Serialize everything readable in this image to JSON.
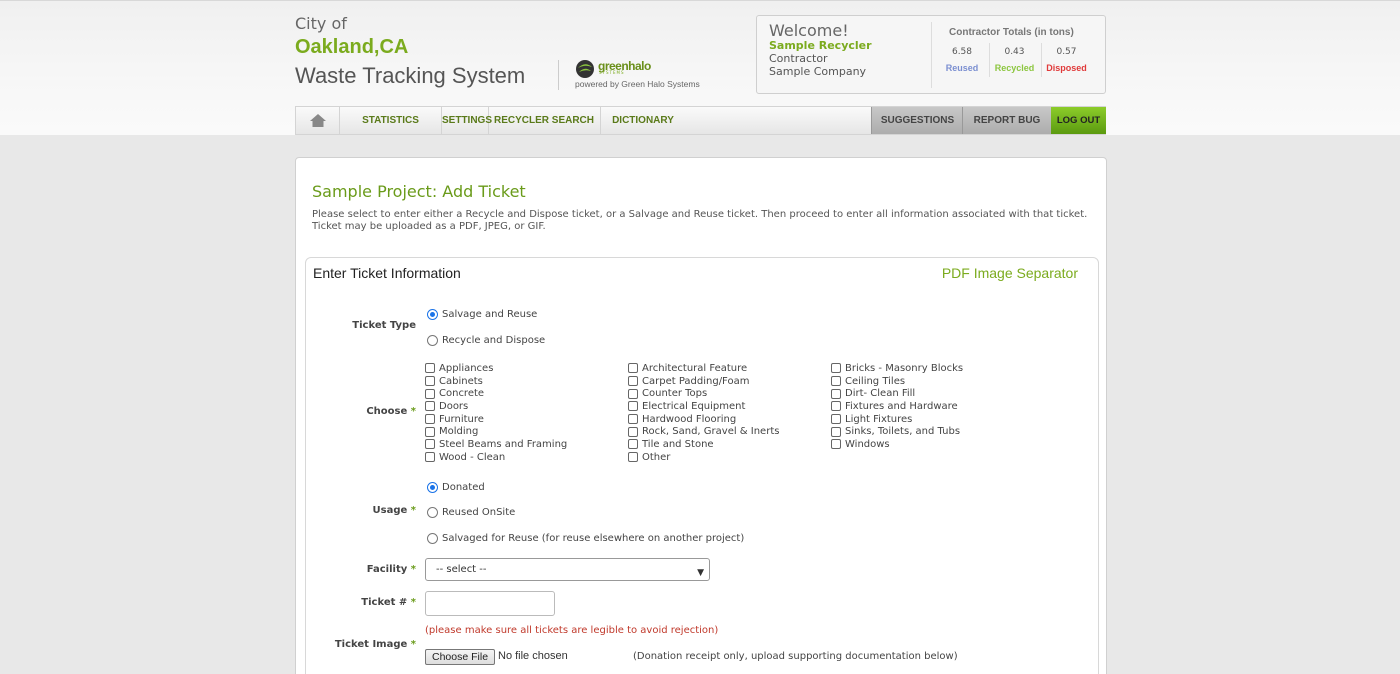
{
  "brand": {
    "city": "City of",
    "name": "Oakland,CA",
    "system": "Waste Tracking System",
    "partner_name": "greenhalo",
    "partner_sub": "SYSTEMS",
    "powered_by": "powered by Green Halo Systems"
  },
  "welcome": {
    "title": "Welcome!",
    "user": "Sample Recycler",
    "role": "Contractor",
    "company": "Sample Company"
  },
  "totals": {
    "title": "Contractor Totals (in tons)",
    "items": [
      {
        "value": "6.58",
        "label": "Reused",
        "color": "#7b8fd1"
      },
      {
        "value": "0.43",
        "label": "Recycled",
        "color": "#8cc63f"
      },
      {
        "value": "0.57",
        "label": "Disposed",
        "color": "#e03a3a"
      }
    ]
  },
  "nav": {
    "home_icon": "home-icon",
    "items": [
      "STATISTICS",
      "SETTINGS",
      "RECYCLER SEARCH",
      "DICTIONARY"
    ],
    "right": [
      "SUGGESTIONS",
      "REPORT BUG"
    ],
    "logout": "LOG OUT"
  },
  "page": {
    "title": "Sample Project: Add Ticket",
    "description": "Please select to enter either a Recycle and Dispose ticket, or a Salvage and Reuse ticket. Then proceed to enter all information associated with that ticket. Ticket may be uploaded as a PDF, JPEG, or GIF."
  },
  "form": {
    "section_title": "Enter Ticket Information",
    "pdf_link": "PDF Image Separator",
    "ticket_type_label": "Ticket Type",
    "ticket_types": [
      {
        "label": "Salvage and Reuse",
        "selected": true
      },
      {
        "label": "Recycle and Dispose",
        "selected": false
      }
    ],
    "choose_label": "Choose",
    "required_mark": "*",
    "choose_columns": [
      [
        "Appliances",
        "Cabinets",
        "Concrete",
        "Doors",
        "Furniture",
        "Molding",
        "Steel Beams and Framing",
        "Wood - Clean"
      ],
      [
        "Architectural Feature",
        "Carpet Padding/Foam",
        "Counter Tops",
        "Electrical Equipment",
        "Hardwood Flooring",
        "Rock, Sand, Gravel & Inerts",
        "Tile and Stone",
        "Other"
      ],
      [
        "Bricks - Masonry Blocks",
        "Ceiling Tiles",
        "Dirt- Clean Fill",
        "Fixtures and Hardware",
        "Light Fixtures",
        "Sinks, Toilets, and Tubs",
        "Windows"
      ]
    ],
    "usage_label": "Usage",
    "usages": [
      {
        "label": "Donated",
        "selected": true
      },
      {
        "label": "Reused OnSite",
        "selected": false
      },
      {
        "label": "Salvaged for Reuse (for reuse elsewhere on another project)",
        "selected": false
      }
    ],
    "facility_label": "Facility",
    "facility_value": "-- select --",
    "ticket_no_label": "Ticket #",
    "ticket_no_value": "",
    "ticket_image_label": "Ticket Image",
    "warning": "(please make sure all tickets are legible to avoid rejection)",
    "choose_file": "Choose File",
    "no_file": "No file chosen",
    "file_note": "(Donation receipt only, upload supporting documentation below)"
  }
}
